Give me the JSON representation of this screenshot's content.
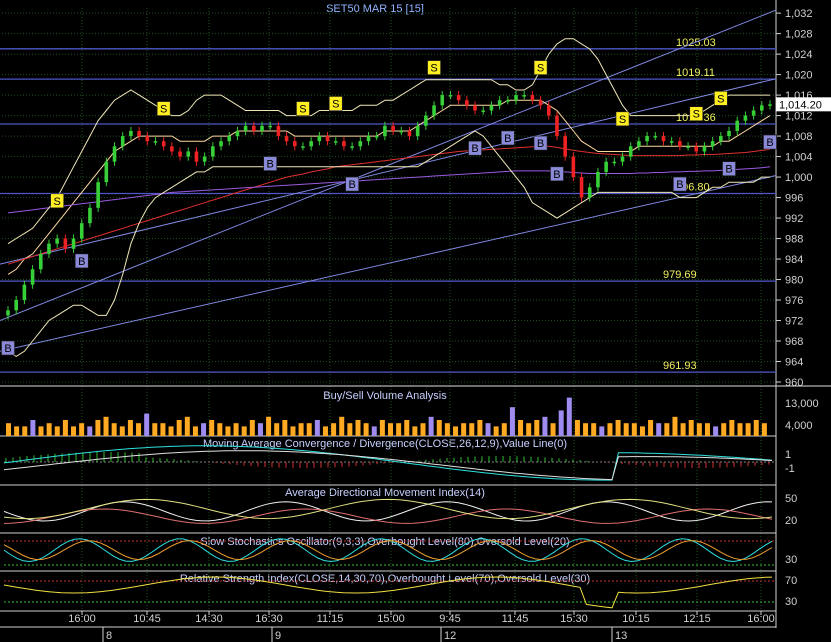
{
  "title": "SET50 MAR 15   [15]",
  "colors": {
    "background": "#000000",
    "grid": "#1e4d1e",
    "axis_text": "#d0d0d0",
    "title_text": "#8fb3ff",
    "level_line": "#4f57c8",
    "level_text": "#f0f060",
    "candle_up": "#38d038",
    "candle_down": "#ee2222",
    "buy_box": "#8a8ad8",
    "sell_box": "#ffee22",
    "volume": "#ffaa22",
    "volume_alt": "#a08cf0",
    "price_label_bg": "#ffffff"
  },
  "chart_data": [
    {
      "type": "line",
      "name": "SET50 MAR 15 [15]",
      "y_ticks": [
        "1,032",
        "1,028",
        "1,024",
        "1,020",
        "1,016",
        "1,012",
        "1,008",
        "1,004",
        "1,000",
        "996",
        "992",
        "988",
        "984",
        "980",
        "976",
        "972",
        "968",
        "964",
        "960"
      ],
      "ylim": [
        960,
        1033
      ],
      "x_tick_labels": [
        "16:00",
        "10:45",
        "14:30",
        "16:30",
        "11:15",
        "15:00",
        "9:45",
        "11:45",
        "15:30",
        "10:15",
        "12:15",
        "16:00"
      ],
      "x_date_labels": [
        "8",
        "9",
        "12",
        "13"
      ],
      "levels": [
        {
          "label": "1025.03",
          "value": 1025.03
        },
        {
          "label": "1019.11",
          "value": 1019.11
        },
        {
          "label": "1010.36",
          "value": 1010.36
        },
        {
          "label": "996.80",
          "value": 996.8
        },
        {
          "label": "979.69",
          "value": 979.69
        },
        {
          "label": "961.93",
          "value": 961.93
        }
      ],
      "last_price_label": "1,014.20",
      "last_price": 1014.2,
      "close": [
        974,
        976,
        979,
        982,
        985,
        987,
        988,
        986,
        988,
        991,
        994,
        999,
        1003,
        1006,
        1008,
        1009,
        1008,
        1007,
        1007,
        1006,
        1005,
        1004,
        1005,
        1003,
        1004,
        1006,
        1007,
        1008,
        1009,
        1010,
        1009,
        1010,
        1010,
        1008,
        1007,
        1006,
        1006,
        1007,
        1008,
        1007,
        1007,
        1006,
        1006,
        1007,
        1008,
        1008,
        1010,
        1009,
        1009,
        1008,
        1010,
        1012,
        1014,
        1016,
        1016,
        1015,
        1014,
        1013,
        1013,
        1014,
        1015,
        1015,
        1016,
        1016,
        1015,
        1014,
        1012,
        1008,
        1004,
        1000,
        996,
        998,
        1001,
        1003,
        1003,
        1004,
        1006,
        1007,
        1008,
        1008,
        1007,
        1007,
        1006,
        1006,
        1005,
        1006,
        1007,
        1008,
        1009,
        1011,
        1012,
        1013,
        1014,
        1014.2
      ],
      "series": [
        {
          "name": "",
          "color": "#ffd9a0",
          "values": [
            981,
            982,
            984,
            985,
            987,
            989,
            991,
            993,
            995,
            997,
            999,
            1001,
            1003,
            1005,
            1006,
            1007,
            1008,
            1008,
            1008,
            1008,
            1008,
            1007,
            1007,
            1007,
            1007,
            1008,
            1008,
            1008,
            1009,
            1009,
            1009,
            1009,
            1009,
            1009,
            1009,
            1008,
            1008,
            1008,
            1008,
            1008,
            1008,
            1008,
            1008,
            1008,
            1008,
            1008,
            1009,
            1009,
            1009,
            1009,
            1010,
            1011,
            1012,
            1013,
            1014,
            1014,
            1014,
            1014,
            1014,
            1014,
            1014,
            1015,
            1015,
            1015,
            1015,
            1015,
            1014,
            1013,
            1011,
            1009,
            1007,
            1006,
            1005,
            1005,
            1005,
            1005,
            1005,
            1006,
            1006,
            1006,
            1006,
            1006,
            1006,
            1006,
            1006,
            1006,
            1006,
            1007,
            1007,
            1008,
            1009,
            1010,
            1011,
            1012
          ]
        },
        {
          "name": "",
          "color": "#e03030",
          "values": [
            983,
            983.5,
            984,
            984.5,
            985,
            985.5,
            986,
            986.5,
            987,
            987.5,
            988,
            988.5,
            989,
            989.5,
            990,
            990.5,
            991,
            991.5,
            992,
            992.5,
            993,
            993.5,
            994,
            994.5,
            995,
            995.5,
            996,
            996.5,
            997,
            997.5,
            998,
            998.5,
            999,
            999.5,
            1000,
            1000.3,
            1000.6,
            1001,
            1001.3,
            1001.6,
            1002,
            1002.2,
            1002.4,
            1002.6,
            1002.8,
            1003,
            1003.2,
            1003.4,
            1003.6,
            1003.8,
            1004,
            1004.2,
            1004.4,
            1004.6,
            1004.8,
            1005,
            1005.1,
            1005.2,
            1005.3,
            1005.4,
            1005.5,
            1005.6,
            1005.7,
            1005.8,
            1005.9,
            1006,
            1006,
            1005.8,
            1005.5,
            1005.2,
            1005,
            1004.8,
            1004.6,
            1004.5,
            1004.4,
            1004.3,
            1004.2,
            1004.2,
            1004.2,
            1004.2,
            1004.2,
            1004.2,
            1004.2,
            1004.3,
            1004.3,
            1004.4,
            1004.4,
            1004.5,
            1004.6,
            1004.7,
            1004.8,
            1005,
            1005.2,
            1005.4
          ]
        },
        {
          "name": "",
          "color": "#9a5ae0",
          "values": [
            993,
            993.2,
            993.4,
            993.6,
            993.8,
            994,
            994.2,
            994.4,
            994.6,
            994.8,
            995,
            995.2,
            995.4,
            995.6,
            995.8,
            996,
            996.2,
            996.4,
            996.6,
            996.8,
            997,
            997.1,
            997.2,
            997.3,
            997.4,
            997.5,
            997.6,
            997.7,
            997.8,
            997.9,
            998,
            998.1,
            998.2,
            998.3,
            998.4,
            998.5,
            998.6,
            998.7,
            998.8,
            998.9,
            999,
            999.1,
            999.2,
            999.3,
            999.4,
            999.5,
            999.6,
            999.7,
            999.8,
            999.9,
            1000,
            1000.1,
            1000.2,
            1000.3,
            1000.4,
            1000.5,
            1000.6,
            1000.7,
            1000.8,
            1000.9,
            1001,
            1001.1,
            1001.2,
            1001.2,
            1001.2,
            1001.2,
            1001.2,
            1001.1,
            1001,
            1000.9,
            1000.8,
            1000.7,
            1000.7,
            1000.7,
            1000.7,
            1000.7,
            1000.7,
            1000.8,
            1000.8,
            1000.9,
            1000.9,
            1001,
            1001,
            1001.1,
            1001.1,
            1001.2,
            1001.2,
            1001.3,
            1001.4,
            1001.5,
            1001.6,
            1001.7,
            1001.8,
            1002
          ]
        },
        {
          "name": "",
          "color": "#f0e8b8",
          "values": [
            987,
            988,
            989,
            990,
            992,
            994,
            996,
            999,
            1002,
            1005,
            1008,
            1011,
            1013,
            1015,
            1016,
            1017,
            1016,
            1015,
            1014,
            1013,
            1012,
            1012,
            1013,
            1015,
            1016,
            1016,
            1016,
            1015,
            1014,
            1013,
            1013,
            1013,
            1013,
            1013,
            1012,
            1012,
            1012,
            1012,
            1013,
            1013,
            1013,
            1013,
            1013,
            1014,
            1014,
            1014,
            1015,
            1015,
            1016,
            1017,
            1018,
            1019,
            1019,
            1019,
            1019,
            1019,
            1019,
            1019,
            1019,
            1019,
            1018,
            1018,
            1017,
            1017,
            1018,
            1021,
            1024,
            1026,
            1027,
            1027,
            1026,
            1025,
            1023,
            1020,
            1017,
            1014,
            1012,
            1012,
            1012,
            1012,
            1012,
            1012,
            1012,
            1012,
            1012,
            1013,
            1014,
            1015,
            1016,
            1016,
            1016,
            1016,
            1016,
            1016
          ]
        },
        {
          "name": "",
          "color": "#f0e8b8",
          "values": [
            966,
            965,
            966,
            968,
            970,
            972,
            973,
            974,
            975,
            975,
            974,
            973,
            973,
            976,
            981,
            987,
            991,
            994,
            996,
            997,
            998,
            999,
            1000,
            1001,
            1001,
            1002,
            1002,
            1002,
            1002,
            1002,
            1002,
            1002,
            1002,
            1002,
            1002,
            1002,
            1002,
            1002,
            1002,
            1002,
            1002,
            1002,
            1002,
            1002,
            1002,
            1002,
            1002,
            1002,
            1002,
            1002,
            1002,
            1003,
            1004,
            1005,
            1006,
            1007,
            1008,
            1009,
            1008,
            1006,
            1004,
            1002,
            1000,
            998,
            995,
            994,
            993,
            992,
            993,
            994,
            995,
            996,
            997,
            997,
            997,
            997,
            997,
            997,
            997,
            997,
            997,
            997,
            996,
            996,
            996,
            997,
            998,
            998,
            999,
            999,
            999,
            999,
            1000,
            1000
          ]
        }
      ]
    },
    {
      "type": "bar",
      "title": "Buy/Sell Volume Analysis",
      "y_ticks": [
        "13,000",
        "4,000"
      ],
      "values": [
        4,
        3,
        3,
        5,
        3,
        4,
        3,
        5,
        3,
        4,
        3,
        5,
        6,
        4,
        3,
        5,
        4,
        7,
        4,
        4,
        3,
        5,
        6,
        3,
        4,
        5,
        4,
        3,
        4,
        3,
        5,
        4,
        6,
        4,
        5,
        3,
        4,
        4,
        5,
        3,
        4,
        6,
        4,
        5,
        4,
        3,
        5,
        4,
        4,
        5,
        3,
        4,
        6,
        5,
        4,
        3,
        4,
        4,
        5,
        4,
        3,
        4,
        9,
        5,
        4,
        5,
        6,
        4,
        8,
        12,
        5,
        4,
        4,
        3,
        4,
        5,
        4,
        4,
        3,
        5,
        4,
        4,
        6,
        4,
        5,
        4,
        4,
        3,
        4,
        5,
        4,
        4,
        5,
        4
      ]
    },
    {
      "type": "line",
      "title": "Moving Average Convergence / Divergence(CLOSE,26,12,9),Value Line(0)",
      "y_ticks": [
        "1",
        "-1"
      ]
    },
    {
      "type": "line",
      "title": "Average Directional Movement Index(14)",
      "y_ticks": [
        "50",
        "20"
      ]
    },
    {
      "type": "line",
      "title": "Slow Stochastics Oscillator(9,3,3),Overbought Level(80),Oversold Level(20)",
      "y_ticks": [
        "30"
      ]
    },
    {
      "type": "line",
      "title": "Relative Strength Index(CLOSE,14,30,70),Overbought Level(70),Oversold Level(30)",
      "y_ticks": [
        "70",
        "30"
      ]
    }
  ],
  "signals": [
    {
      "type": "B",
      "index": 0
    },
    {
      "type": "S",
      "index": 6
    },
    {
      "type": "B",
      "index": 9
    },
    {
      "type": "S",
      "index": 19
    },
    {
      "type": "B",
      "index": 32
    },
    {
      "type": "S",
      "index": 36
    },
    {
      "type": "S",
      "index": 40
    },
    {
      "type": "B",
      "index": 42
    },
    {
      "type": "S",
      "index": 52
    },
    {
      "type": "B",
      "index": 57
    },
    {
      "type": "S",
      "index": 65
    },
    {
      "type": "B",
      "index": 61
    },
    {
      "type": "B",
      "index": 65
    },
    {
      "type": "B",
      "index": 67
    },
    {
      "type": "S",
      "index": 75
    },
    {
      "type": "S",
      "index": 84
    },
    {
      "type": "B",
      "index": 82
    },
    {
      "type": "B",
      "index": 88
    },
    {
      "type": "S",
      "index": 87
    },
    {
      "type": "B",
      "index": 96
    },
    {
      "type": "B",
      "index": 100
    }
  ]
}
